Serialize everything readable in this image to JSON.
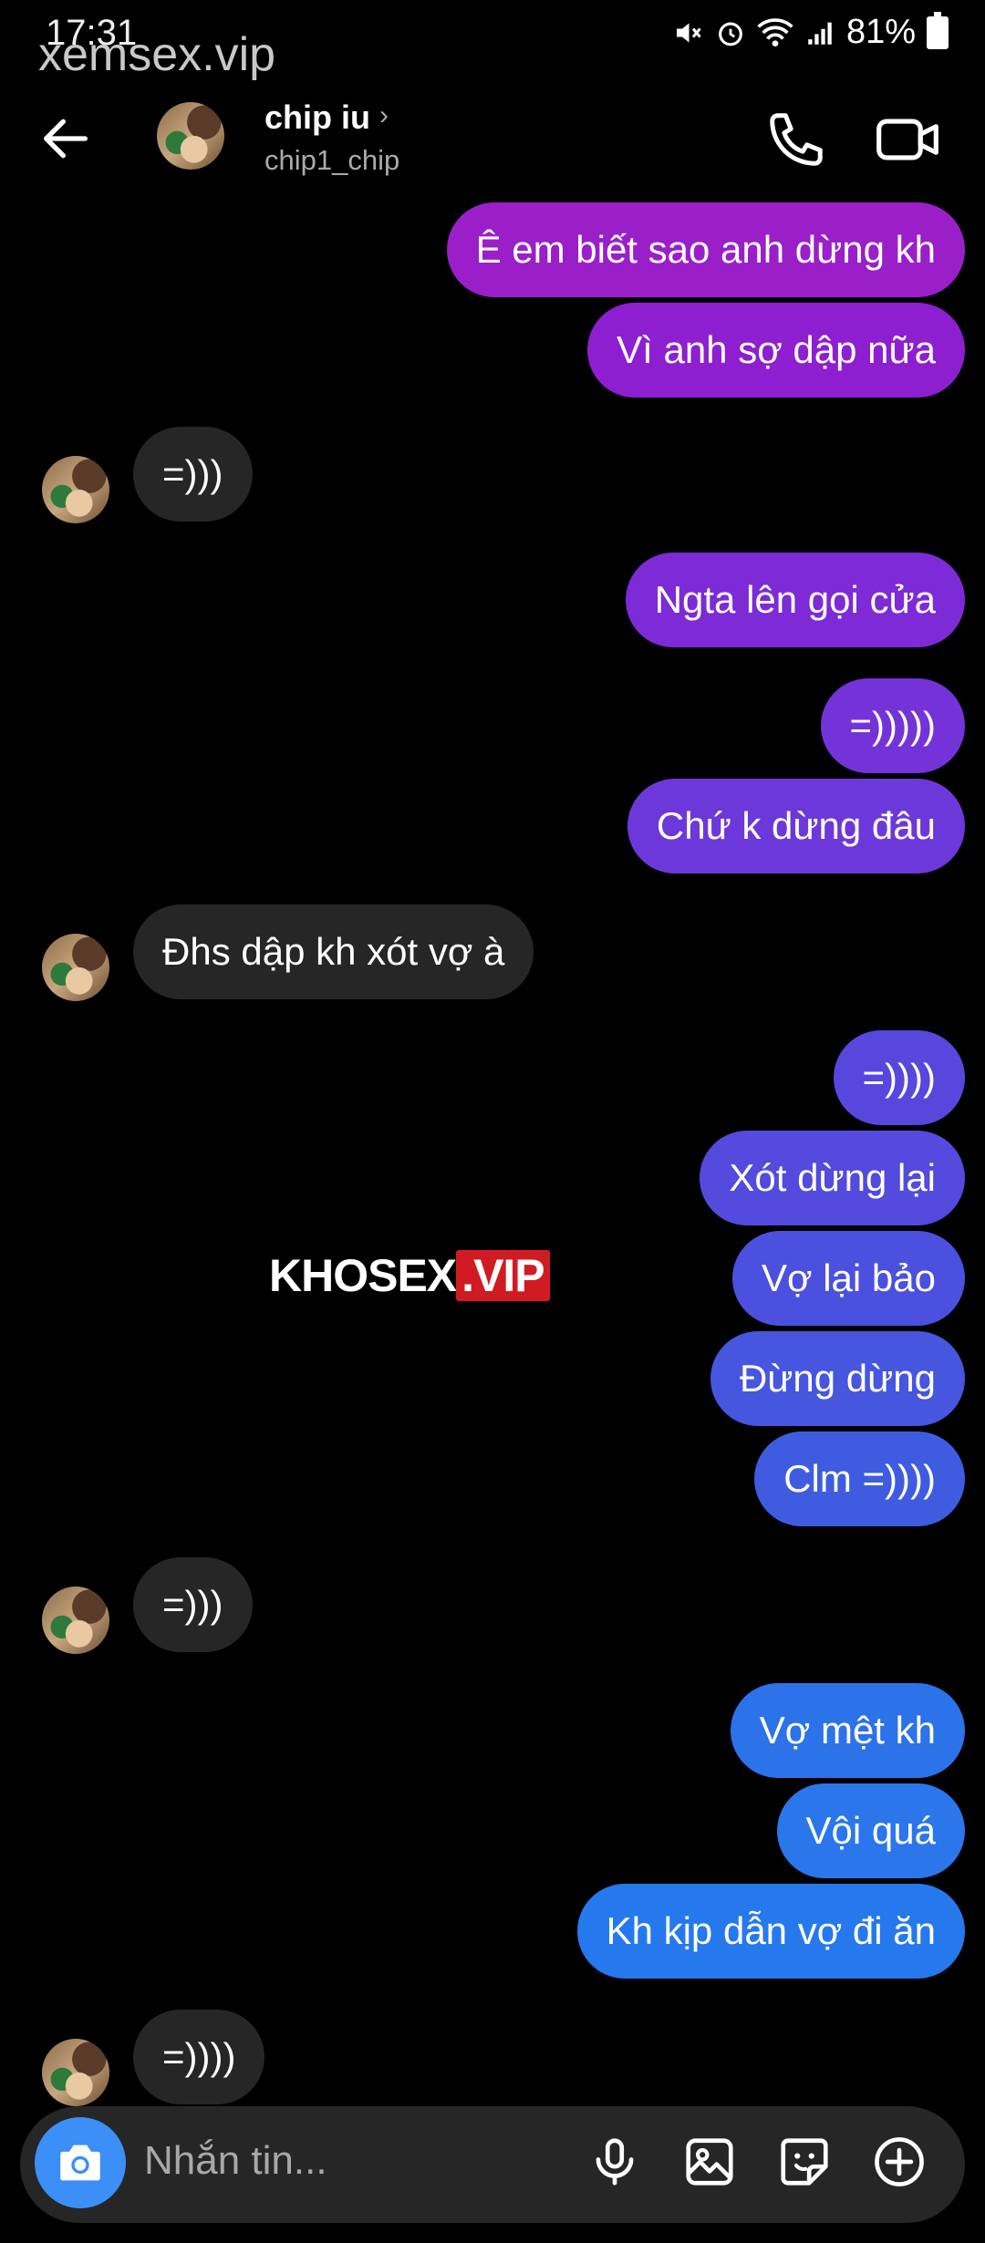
{
  "status_bar": {
    "time": "17:31",
    "battery": "81%"
  },
  "watermark_top": "xemsex.vip",
  "watermark_center": {
    "left": "KHOSEX",
    "right": ".VIP"
  },
  "header": {
    "name": "chip iu",
    "chevron": "›",
    "username": "chip1_chip"
  },
  "messages": [
    {
      "dir": "out",
      "text": "Ê em biết sao anh dừng kh",
      "color": "#9a1fc9"
    },
    {
      "dir": "out",
      "text": "Vì anh sợ dập nữa",
      "color": "#8e1fd0"
    },
    {
      "dir": "in",
      "text": "=)))"
    },
    {
      "dir": "out",
      "text": "Ngta lên gọi cửa",
      "color": "#7c2bd6"
    },
    {
      "dir": "out",
      "text": "=)))))",
      "color": "#7433d8"
    },
    {
      "dir": "out",
      "text": "Chứ k dừng đâu",
      "color": "#6d38d9"
    },
    {
      "dir": "in",
      "text": "Đhs dập kh xót vợ à"
    },
    {
      "dir": "out",
      "text": "=))))",
      "color": "#5847dc"
    },
    {
      "dir": "out",
      "text": "Xót dừng lại",
      "color": "#524bdd"
    },
    {
      "dir": "out",
      "text": "Vợ lại bảo",
      "color": "#4c50de"
    },
    {
      "dir": "out",
      "text": "Đừng dừng",
      "color": "#4656df"
    },
    {
      "dir": "out",
      "text": "Clm =))))",
      "color": "#3f5ce1"
    },
    {
      "dir": "in",
      "text": "=)))"
    },
    {
      "dir": "out",
      "text": "Vợ mệt kh",
      "color": "#2c72e9"
    },
    {
      "dir": "out",
      "text": "Vội quá",
      "color": "#2a76ea"
    },
    {
      "dir": "out",
      "text": "Kh kịp dẫn vợ đi ăn",
      "color": "#2679ec"
    },
    {
      "dir": "in",
      "text": "=))))"
    }
  ],
  "composer": {
    "placeholder": "Nhắn tin..."
  }
}
